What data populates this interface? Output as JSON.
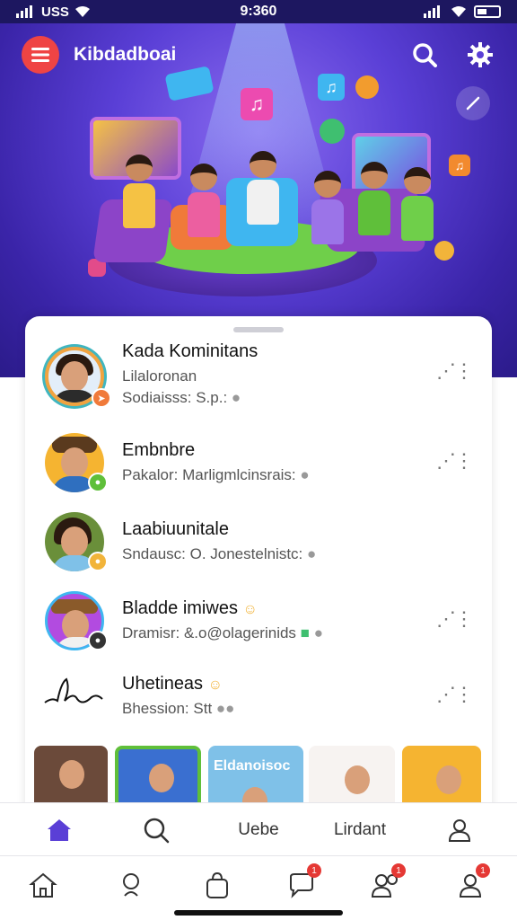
{
  "status_bar": {
    "carrier": "USS",
    "time": "9:360"
  },
  "header": {
    "title": "Kibdadboai"
  },
  "list": {
    "items": [
      {
        "name": "Kada Kominitans",
        "line1": "Lilaloronan",
        "line2": "Sodiaisss: S.p.:"
      },
      {
        "name": "Embnbre",
        "line1": "Pakalor: Marligmlcinsrais:",
        "line2": ""
      },
      {
        "name": "Laabiuunitale",
        "line1": "Sndausc: O. Jonestelnistc:",
        "line2": ""
      },
      {
        "name": "Bladde imiwes",
        "line1": "Dramisr: &.o@olagerinids",
        "line2": ""
      },
      {
        "name": "Uhetineas",
        "line1": "Bhession: Stt",
        "line2": ""
      }
    ],
    "thumb_label": "Eldanoisoc"
  },
  "tabs_top": {
    "tab3": "Uebe",
    "tab4": "Lirdant"
  },
  "tabs_bottom": {
    "badge_2": "1",
    "badge_3": "1",
    "badge_4": "1"
  }
}
